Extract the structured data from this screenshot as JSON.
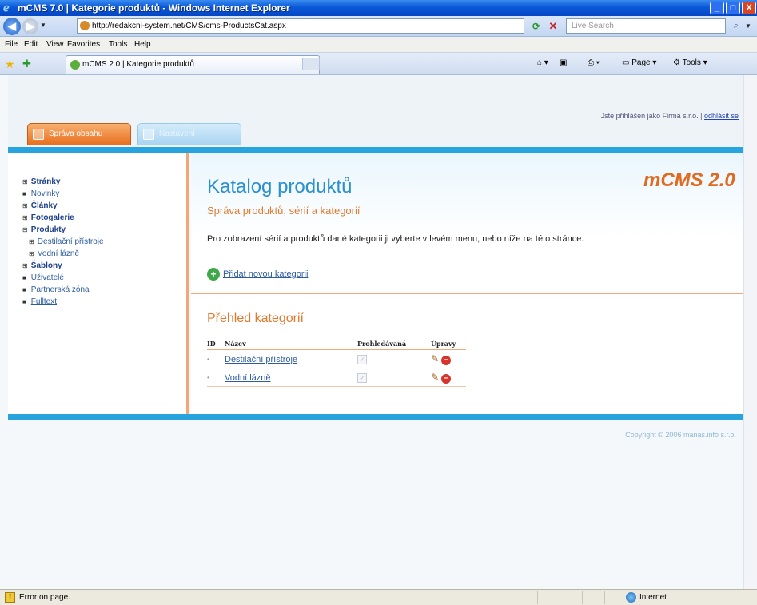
{
  "window": {
    "title": "mCMS 7.0 | Kategorie produktů - Windows Internet Explorer",
    "minimize": "_",
    "maximize": "□",
    "close": "X"
  },
  "address_bar": {
    "url": "http://redakcni-system.net/CMS/cms-ProductsCat.aspx",
    "search_placeholder": "Live Search"
  },
  "menu": [
    "File",
    "Edit",
    "View",
    "Favorites",
    "Tools",
    "Help"
  ],
  "browser_tab": {
    "label": "mCMS 2.0 | Kategorie produktů"
  },
  "command_bar": {
    "page": "Page",
    "tools": "Tools"
  },
  "cms": {
    "login_text": "Jste přihlášen jako Firma s.r.o. |",
    "logout_link": "odhlásit se",
    "tabs": [
      "Správa obsahu",
      "Nastavení"
    ],
    "brand": "mCMS 2.0"
  },
  "sidebar": {
    "items": [
      {
        "label": "Stránky",
        "bold": true,
        "bullet": "⊞"
      },
      {
        "label": "Novinky",
        "bold": false,
        "bullet": "■"
      },
      {
        "label": "Články",
        "bold": true,
        "bullet": "⊞"
      },
      {
        "label": "Fotogalerie",
        "bold": true,
        "bullet": "⊞"
      },
      {
        "label": "Produkty",
        "bold": true,
        "bullet": "⊟"
      },
      {
        "label": "Destilační přístroje",
        "bold": false,
        "bullet": "⊞",
        "sub": true
      },
      {
        "label": "Vodní lázně",
        "bold": false,
        "bullet": "⊞",
        "sub": true
      },
      {
        "label": "Šablony",
        "bold": true,
        "bullet": "⊞"
      },
      {
        "label": "Uživatelé",
        "bold": false,
        "bullet": "■"
      },
      {
        "label": "Partnerská zóna",
        "bold": false,
        "bullet": "■"
      },
      {
        "label": "Fulltext",
        "bold": false,
        "bullet": "■"
      }
    ]
  },
  "main": {
    "title": "Katalog produktů",
    "subtitle": "Správa produktů, sérií a kategorií",
    "intro": "Pro zobrazení sérií a produktů dané kategorii ji vyberte v levém menu, nebo níže na této stránce.",
    "add_category": "Přidat novou kategorii",
    "overview_title": "Přehled kategorií",
    "table": {
      "headers": [
        "ID",
        "Název",
        "Prohledávaná",
        "Úpravy"
      ],
      "rows": [
        {
          "id": "•",
          "name": "Destilační přístroje",
          "searchable": true
        },
        {
          "id": "•",
          "name": "Vodní lázně",
          "searchable": true
        }
      ]
    },
    "copyright": "Copyright © 2006 manas.info s.r.o."
  },
  "status_bar": {
    "message": "Error on page.",
    "zone": "Internet"
  },
  "colors": {
    "accent_blue": "#27a4de",
    "accent_orange": "#e07a30",
    "link": "#2d5c9e"
  }
}
